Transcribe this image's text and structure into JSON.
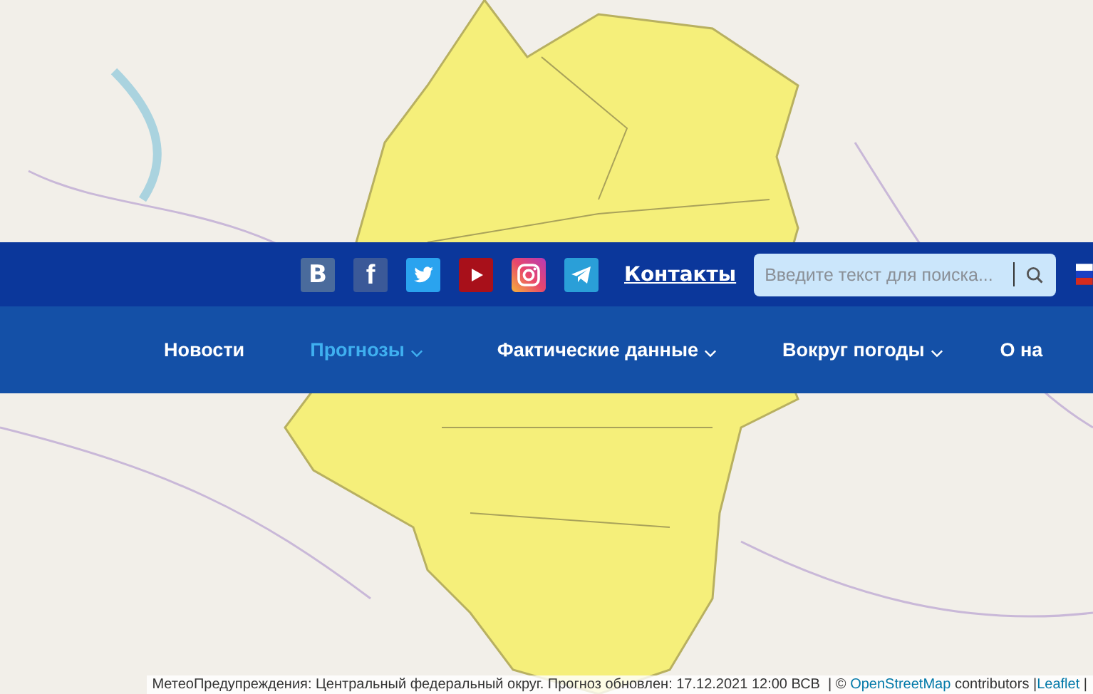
{
  "social": [
    {
      "kind": "vk",
      "glyph": "В"
    },
    {
      "kind": "facebook",
      "glyph": "f"
    },
    {
      "kind": "twitter"
    },
    {
      "kind": "youtube"
    },
    {
      "kind": "instagram"
    },
    {
      "kind": "telegram"
    }
  ],
  "contacts_link": "Контакты",
  "search": {
    "placeholder": "Введите текст для поиска..."
  },
  "nav": [
    {
      "label": "Новости",
      "selected": false,
      "dropdown": false
    },
    {
      "label": "Прогнозы",
      "selected": true,
      "dropdown": true
    },
    {
      "label": "Фактические данные",
      "selected": false,
      "dropdown": true
    },
    {
      "label": "Вокруг погоды",
      "selected": false,
      "dropdown": true
    },
    {
      "label": "О на",
      "selected": false,
      "dropdown": false
    }
  ],
  "attribution": {
    "text": "МетеоПредупреждения: Центральный федеральный округ. Прогноз обновлен: 17.12.2021 12:00 ВСВ  | © ",
    "osm_link": "OpenStreetMap",
    "contributors": " contributors |",
    "leaflet_link": "Leaflet",
    "tail": " |"
  }
}
